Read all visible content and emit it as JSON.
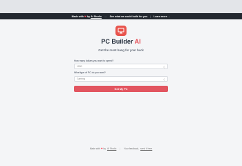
{
  "promo_bar": {
    "made_with_prefix": "Made with",
    "made_with_by": "by",
    "made_with_link": "AI Studio",
    "middle_text": "See what we could build for you",
    "learn_more": "Learn more",
    "arrow_icon": "arrow-right-icon",
    "heart_icon": "heart-icon"
  },
  "header": {
    "logo_icon": "computer-monitor-icon",
    "title_main": "PC Builder",
    "title_accent": "AI",
    "subtitle": "Get the most bang for your buck"
  },
  "form": {
    "budget_label": "How many dollars you want to spend?",
    "budget_value": "1000",
    "use_label": "What type of PC do you want?",
    "use_value": "Gaming",
    "submit_label": "Get My PC"
  },
  "footer": {
    "made_with_prefix": "Made with",
    "made_with_by": "by",
    "made_with_link": "AI Studio",
    "feedback_prefix": "Your feedback,",
    "feedback_link": "send it here"
  },
  "colors": {
    "accent": "#e34850",
    "button": "#e25560",
    "promo_bg": "#22272f"
  }
}
